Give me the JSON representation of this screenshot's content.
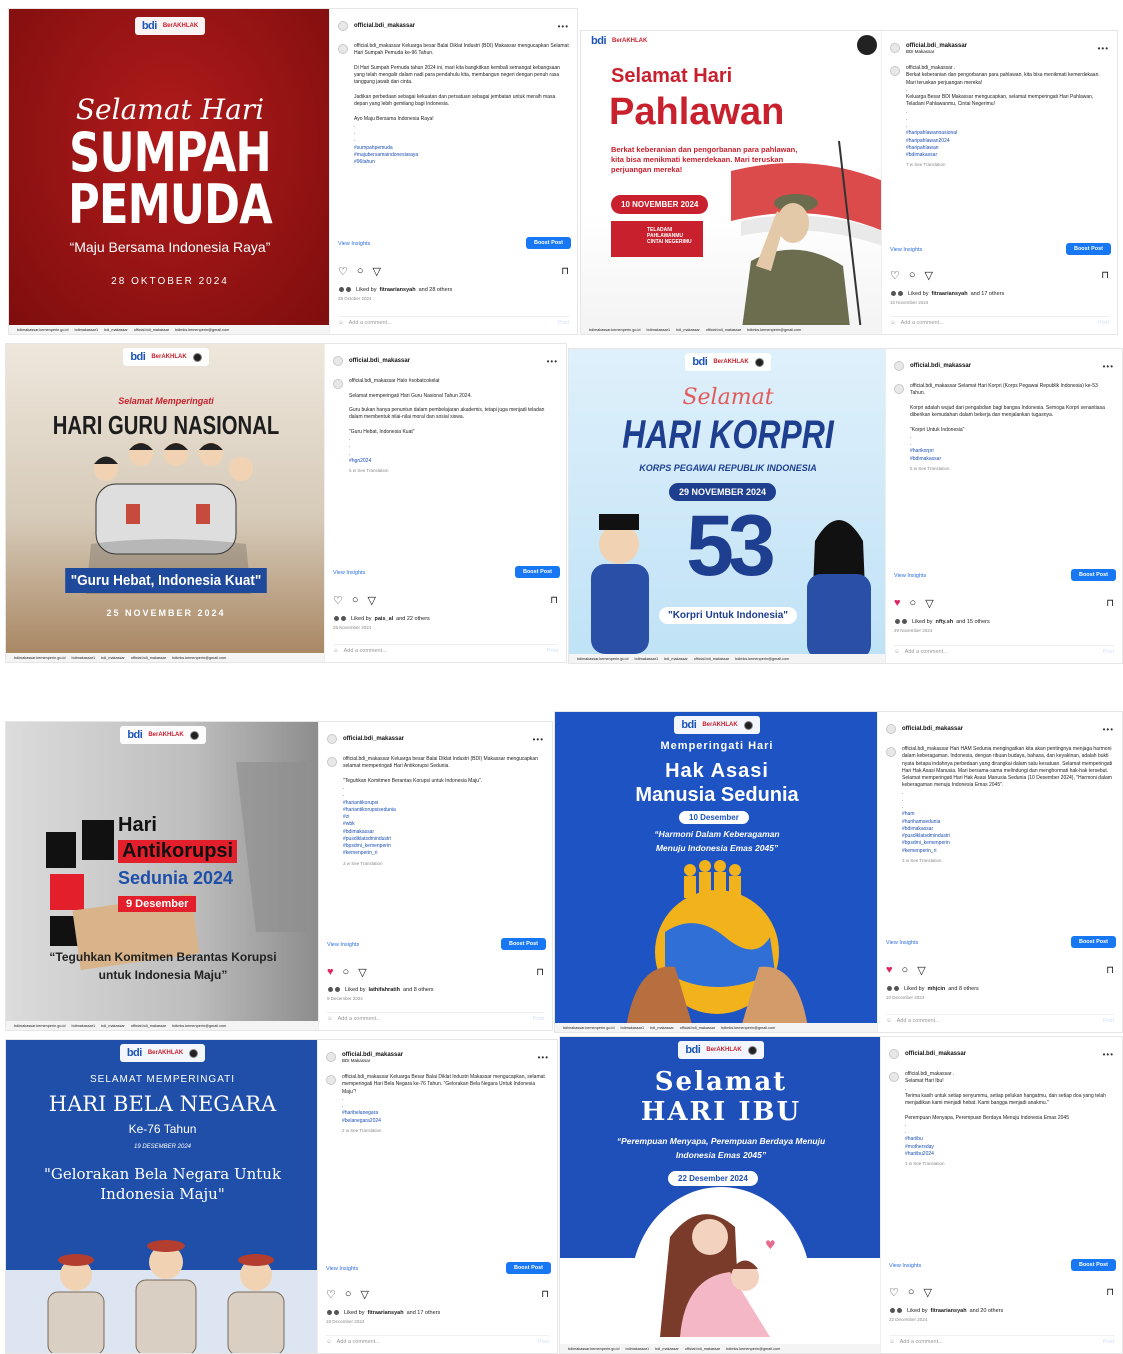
{
  "posts": [
    {
      "username": "official.bdi_makassar",
      "subtitle": "",
      "caption": "official.bdi_makassar Keluarga besar Balai Diklat Industri (BDI) Makassar mengucapkan Selamat Hari Sumpah Pemuda ke-96 Tahun.\n\nDi Hari Sumpah Pemuda tahun 2024 ini, mari kita bangkitkan kembali semangat kebangsaan yang telah mengalir dalam nadi para pendahulu kita, membangun negeri dengan penuh rasa tanggung jawab dan cinta.\n\nJadikan perbedaan sebagai kekuatan dan persatuan sebagai jembatan untuk meraih masa depan yang lebih gemilang bagi Indonesia.\n\nAyo Maju Bersama Indonesia Raya!\n.\n.\n.",
      "hashtags": "#sumpahpemuda\n#majubersamaindonesiaraya\n#96tahun",
      "meta": "",
      "liked_by": "fitraariansyah",
      "likes_others": "and 28 others",
      "date": "28 October 2024",
      "liked": false,
      "poster": {
        "script": "Selamat Hari",
        "title1": "SUMPAH",
        "title2": "PEMUDA",
        "quote": "“Maju Bersama Indonesia Raya”",
        "date": "28 OKTOBER 2024"
      }
    },
    {
      "username": "official.bdi_makassar",
      "subtitle": "BDI Makassar",
      "caption": "official.bdi_makassar .\nBerkat keberanian dan pengorbanan para pahlawan, kita bisa menikmati kemerdekaan. Mari teruskan perjuangan mereka!\n.\nKeluarga Besar BDI Makassar mengucapkan, selamat memperingati Hari Pahlawan, Teladani Pahlawanmu, Cintai Negerimu!\n.\n.\n.",
      "hashtags": "#haripahlawannasional\n#haripahlawan2024\n#haripahlawan\n#bdimakassar",
      "meta": "7 w    See Translation",
      "liked_by": "fitraariansyah",
      "likes_others": "and 17 others",
      "date": "10 November 2024",
      "liked": false,
      "poster": {
        "line1": "Selamat Hari",
        "title": "Pahlawan",
        "body": "Berkat keberanian dan pengorbanan para pahlawan, kita bisa menikmati kemerdekaan. Mari teruskan perjuangan mereka!",
        "date": "10 NOVEMBER 2024",
        "badge": "TELADANI PAHLAWANMU CINTAI NEGERIMU"
      }
    },
    {
      "username": "official.bdi_makassar",
      "subtitle": "",
      "caption": "official.bdi_makassar Halo #sobatcokelat\n\nSelamat memperingati Hari Guru Nasional Tahun 2024.\n\nGuru bukan hanya penuntun dalam pembelajaran akademis, tetapi juga menjadi teladan dalam membentuk nilai-nilai moral dan sosial siswa.\n\n\"Guru Hebat, Indonesia Kuat\"\n.\n.\n.",
      "hashtags": "#hgn2024",
      "meta": "5 w    See Translation",
      "liked_by": "pais_al",
      "likes_others": "and 22 others",
      "date": "25 November 2024",
      "liked": false,
      "poster": {
        "kicker": "Selamat Memperingati",
        "title": "HARI GURU NASIONAL",
        "quote": "\"Guru Hebat, Indonesia Kuat\"",
        "date": "25 NOVEMBER 2024"
      }
    },
    {
      "username": "official.bdi_makassar",
      "subtitle": "",
      "caption": "official.bdi_makassar Selamat Hari Korpri (Korps Pegawai Republik Indonesia) ke-53 Tahun.\n\nKorpri adalah wujud dari pengabdian bagi bangsa Indonesia. Semoga Korpri senantiasa diberikan kemudahan dalam bekerja dan menjalankan tugasnya.\n\n\"Korpri Untuk Indonesia\"\n.\n.",
      "hashtags": "#harikorpri\n#bdimakassar",
      "meta": "5 w    See Translation",
      "liked_by": "nfty.sh",
      "likes_others": "and 15 others",
      "date": "29 November 2024",
      "liked": true,
      "poster": {
        "script": "Selamat",
        "title": "HARI KORPRI",
        "sub": "KORPS PEGAWAI REPUBLIK INDONESIA",
        "date": "29 NOVEMBER 2024",
        "number": "53",
        "quote": "\"Korpri Untuk Indonesia\""
      }
    },
    {
      "username": "official.bdi_makassar",
      "subtitle": "",
      "caption": "official.bdi_makassar Keluarga besar Balai Diklat Industri (BDI) Makassar mengucapkan selamat memperingati Hari Antikorupsi Sedunia.\n\n\"Teguhkan Komitmen Berantas Korupsi untuk Indonesia Maju\".\n.\n.",
      "hashtags": "#hariantikorupsi\n#hariantikorupsisedunia\n#zi\n#wbk\n#bdimakassar\n#pusdiklatsdmindustri\n#bpsdmi_kemenperin\n#kemenperin_ri",
      "meta": "3 w    See Translation",
      "liked_by": "lathifahratih",
      "likes_others": "and 8 others",
      "date": "9 December 2024",
      "liked": true,
      "poster": {
        "l1": "Hari",
        "l2": "Antikorupsi",
        "l3": "Sedunia 2024",
        "date": "9 Desember",
        "quote": "“Teguhkan Komitmen Berantas Korupsi untuk Indonesia Maju”"
      }
    },
    {
      "username": "official.bdi_makassar",
      "subtitle": "",
      "caption": "official.bdi_makassar Hari HAM Sedunia mengingatkan kita akan pentingnya menjaga harmoni dalam keberagaman. Indonesia, dengan ribuan budaya, bahasa, dan keyakinan, adalah bukti nyata betapa indahnya perbedaan yang dirangkai dalam satu kesatuan. Selamat memperingati Hari Hak Asasi Manusia. Mari bersama-sama melindungi dan menghormati hak-hak tersebut. Selamat memperingati Hari Hak Asasi Manusia Sedunia (10 Desember 2024), \"Harmoni dalam keberagaman menuju Indonesia Emas 2045\".\n.\n.\n.",
      "hashtags": "#ham\n#harihamsedunia\n#bdimakassar\n#pusdiklatsdmindustri\n#bpsdmi_kemenperin\n#kemenperin_ri",
      "meta": "3 w    See Translation",
      "liked_by": "mhjcin",
      "likes_others": "and 8 others",
      "date": "10 December 2024",
      "liked": true,
      "poster": {
        "kicker": "Memperingati Hari",
        "title1": "Hak Asasi",
        "title2": "Manusia Sedunia",
        "date": "10 Desember",
        "quote": "“Harmoni Dalam Keberagaman Menuju Indonesia Emas 2045”"
      }
    },
    {
      "username": "official.bdi_makassar",
      "subtitle": "BDI Makassar",
      "caption": "official.bdi_makassar Keluarga Besar Balai Diklat Industri Makassar mengucapkan, selamat memperingati Hari Bela Negara ke-76 Tahun. \"Gelorakan Bela Negara Untuk Indonesia Maju\"!\n.\n.",
      "hashtags": "#haribelanegara\n#belanegara2024",
      "meta": "2 w    See Translation",
      "liked_by": "fitraariansyah",
      "likes_others": "and 17 others",
      "date": "19 December 2024",
      "liked": false,
      "poster": {
        "kicker": "SELAMAT MEMPERINGATI",
        "title": "HARI BELA NEGARA",
        "sub": "Ke-76 Tahun",
        "date": "19 DESEMBER 2024",
        "quote": "\"Gelorakan Bela Negara Untuk Indonesia Maju\""
      }
    },
    {
      "username": "official.bdi_makassar",
      "subtitle": "",
      "caption": "official.bdi_makassar .\nSelamat Hari Ibu!\n.\nTerima kasih untuk setiap senyummu, setiap pelukan hangatmu, dan setiap doa yang telah menjadikan kami menjadi hebat. Kami bangga menjadi anakmu.\"\n\nPerempuan Menyapa, Perempuan Berdaya Menuju Indonesia Emas 2045\n.\n.",
      "hashtags": "#hariibu\n#mothersday\n#hariibu2024",
      "meta": "1 w    See Translation",
      "liked_by": "fitraariansyah",
      "likes_others": "and 20 others",
      "date": "22 December 2024",
      "liked": false,
      "poster": {
        "title1": "Selamat",
        "title2": "HARI IBU",
        "quote": "“Perempuan Menyapa, Perempuan Berdaya Menuju Indonesia Emas 2045”",
        "date": "22 Desember 2024"
      }
    }
  ],
  "ui": {
    "view_insights": "View Insights",
    "boost_post": "Boost Post",
    "add_comment": "Add a comment...",
    "post_label": "Post",
    "liked_by_prefix": "Liked by",
    "logo_bdi": "bdi",
    "logo_makassar": "MAKASSAR",
    "logo_berakhlak": "BerAKHLAK",
    "footer_items": [
      "bdimakassar.kemenperin.go.id",
      "bdimakassar1",
      "bdi_makassar",
      "official.bdi_makassar",
      "bdimks.kemenperin@gmail.com"
    ]
  }
}
